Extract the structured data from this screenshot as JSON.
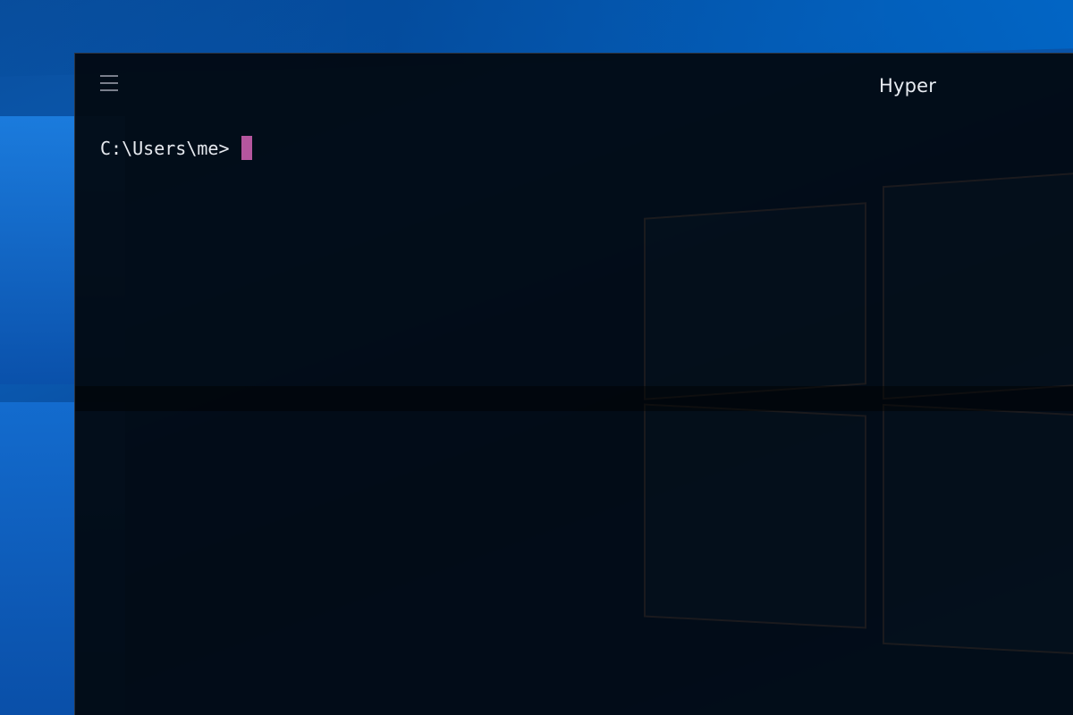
{
  "window": {
    "title": "Hyper"
  },
  "terminal": {
    "prompt": "C:\\Users\\me>",
    "input": ""
  },
  "icons": {
    "menu": "hamburger-menu-icon"
  },
  "colors": {
    "cursor": "#b5569e",
    "background": "#02080f",
    "text": "#e6e9ef",
    "desktop": "#0b5cb5"
  }
}
